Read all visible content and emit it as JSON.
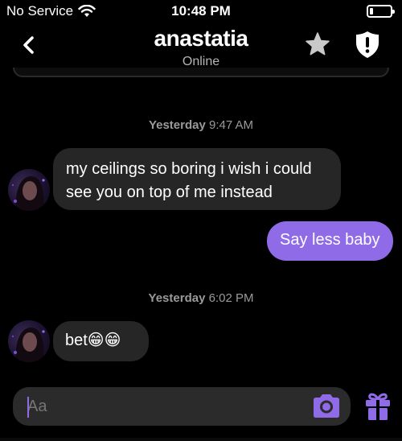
{
  "status": {
    "carrier": "No Service",
    "time": "10:48 PM"
  },
  "header": {
    "title": "anastatia",
    "subtitle": "Online"
  },
  "messages": {
    "group1": {
      "day": "Yesterday",
      "time": "9:47 AM",
      "incoming_line1": "my ceilings so boring i wish i could",
      "incoming_line2": "see you on top of me instead",
      "outgoing": "Say less baby"
    },
    "group2": {
      "day": "Yesterday",
      "time": "6:02 PM",
      "incoming": "bet😁😁"
    }
  },
  "composer": {
    "placeholder": "Aa"
  },
  "icons": {
    "back": "chevron-left-icon",
    "favorite": "star-icon",
    "safety": "shield-icon",
    "camera": "camera-icon",
    "gift": "gift-icon",
    "wifi": "wifi-icon",
    "battery": "battery-icon"
  },
  "colors": {
    "accent": "#8f6be8",
    "background": "#000000",
    "bubble_incoming": "#262626"
  }
}
